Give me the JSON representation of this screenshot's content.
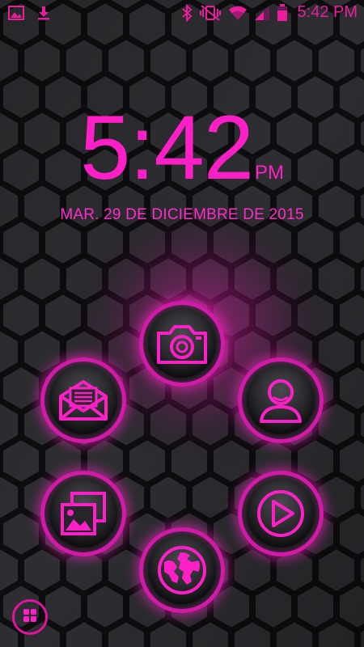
{
  "status_bar": {
    "left_icons": [
      "image-icon",
      "download-icon"
    ],
    "right_icons": [
      "bluetooth-icon",
      "vibrate-icon",
      "wifi-icon",
      "signal-icon",
      "battery-icon"
    ],
    "time": "5:42 PM"
  },
  "lockscreen": {
    "time": "5:42",
    "ampm": "PM",
    "date": "MAR. 29 DE DICIEMBRE DE 2015"
  },
  "apps": [
    {
      "id": "camera",
      "icon": "camera-icon"
    },
    {
      "id": "messaging",
      "icon": "envelope-icon"
    },
    {
      "id": "contacts",
      "icon": "person-icon"
    },
    {
      "id": "gallery",
      "icon": "gallery-icon"
    },
    {
      "id": "media",
      "icon": "play-icon"
    },
    {
      "id": "browser",
      "icon": "globe-icon"
    }
  ],
  "drawer": {
    "icon": "app-drawer-icon"
  },
  "colors": {
    "accent": "#ff1fc6",
    "ring": "#d21aa8",
    "background": "#1a1a1c"
  }
}
